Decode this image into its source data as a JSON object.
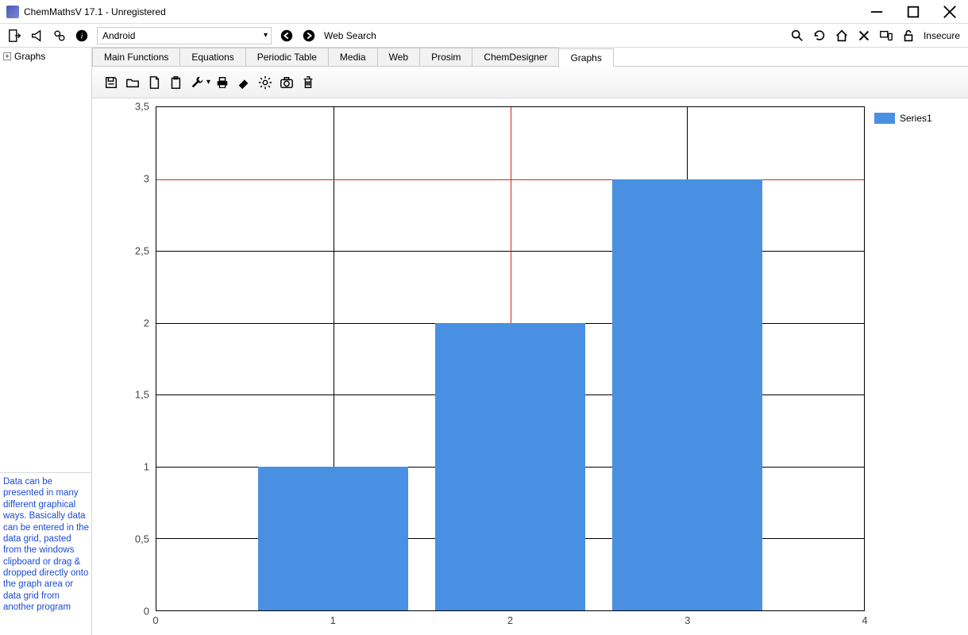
{
  "window": {
    "title": "ChemMathsV 17.1 - Unregistered"
  },
  "toolbar": {
    "platform_select": "Android",
    "web_search_label": "Web Search",
    "insecure_label": "Insecure"
  },
  "tree": {
    "root_label": "Graphs"
  },
  "help_text": "Data can be presented in many different graphical ways. Basically data can be entered in the data grid, pasted from the windows clipboard or drag & dropped directly onto the graph area or data grid from another program",
  "tabs": [
    {
      "label": "Main Functions",
      "active": false
    },
    {
      "label": "Equations",
      "active": false
    },
    {
      "label": "Periodic Table",
      "active": false
    },
    {
      "label": "Media",
      "active": false
    },
    {
      "label": "Web",
      "active": false
    },
    {
      "label": "Prosim",
      "active": false
    },
    {
      "label": "ChemDesigner",
      "active": false
    },
    {
      "label": "Graphs",
      "active": true
    }
  ],
  "legend": {
    "series1": "Series1"
  },
  "chart_data": {
    "type": "bar",
    "categories": [
      1,
      2,
      3
    ],
    "values": [
      1,
      2,
      3
    ],
    "series_name": "Series1",
    "xlim": [
      0,
      4
    ],
    "ylim": [
      0,
      3.5
    ],
    "x_ticks": [
      0,
      1,
      2,
      3,
      4
    ],
    "y_ticks": [
      0,
      0.5,
      1,
      1.5,
      2,
      2.5,
      3,
      3.5
    ],
    "y_tick_labels": [
      "0",
      "0,5",
      "1",
      "1,5",
      "2",
      "2,5",
      "3",
      "3,5"
    ],
    "title": "",
    "xlabel": "",
    "ylabel": "",
    "legend_position": "right",
    "crosshair": {
      "x": 2,
      "y": 3
    },
    "bar_color": "#4a90e2"
  }
}
